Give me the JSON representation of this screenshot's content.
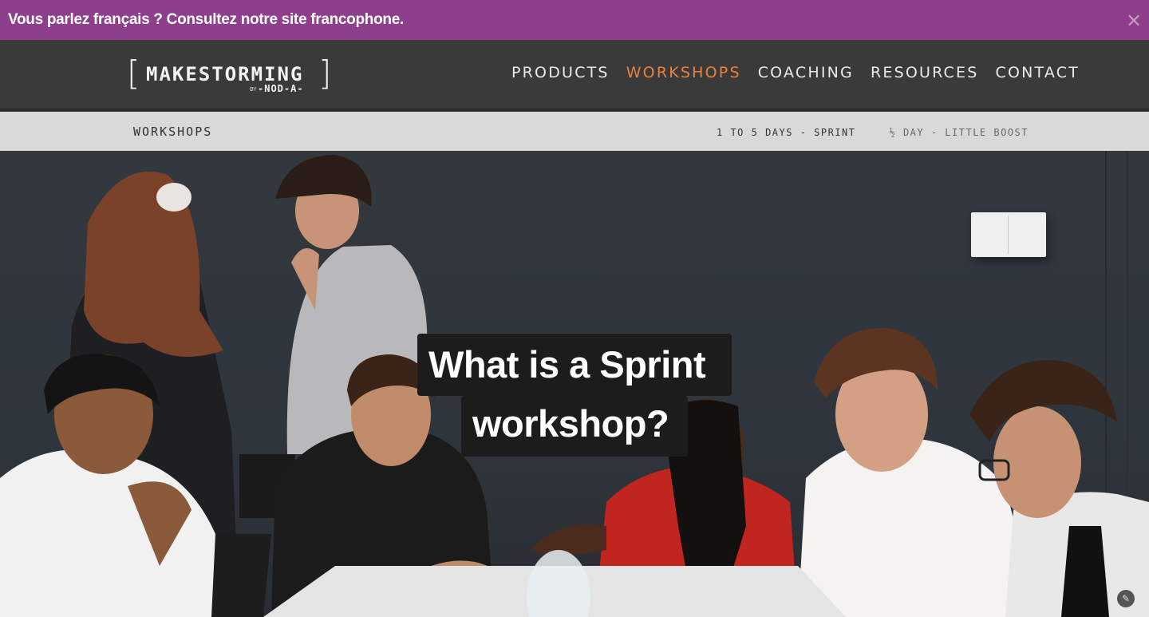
{
  "banner": {
    "message": "Vous parlez français ? Consultez notre site francophone.",
    "close_glyph": "×"
  },
  "header": {
    "logo_word": "MAKESTORMING",
    "logo_by": "BY",
    "logo_sub": "-NOD-A-",
    "nav": [
      {
        "label": "PRODUCTS",
        "active": false
      },
      {
        "label": "WORKSHOPS",
        "active": true
      },
      {
        "label": "COACHING",
        "active": false
      },
      {
        "label": "RESOURCES",
        "active": false
      },
      {
        "label": "CONTACT",
        "active": false
      }
    ]
  },
  "subnav": {
    "section": "WORKSHOPS",
    "links": [
      "1 TO 5 DAYS - SPRINT",
      "½ DAY - LITTLE BOOST"
    ]
  },
  "hero": {
    "title_line1": "What is a Sprint",
    "title_line2": "workshop?"
  },
  "colors": {
    "banner": "#8e3f8c",
    "nav_bg": "#3a3a3a",
    "accent": "#e8813d",
    "subnav_bg": "#d9d9d9"
  }
}
